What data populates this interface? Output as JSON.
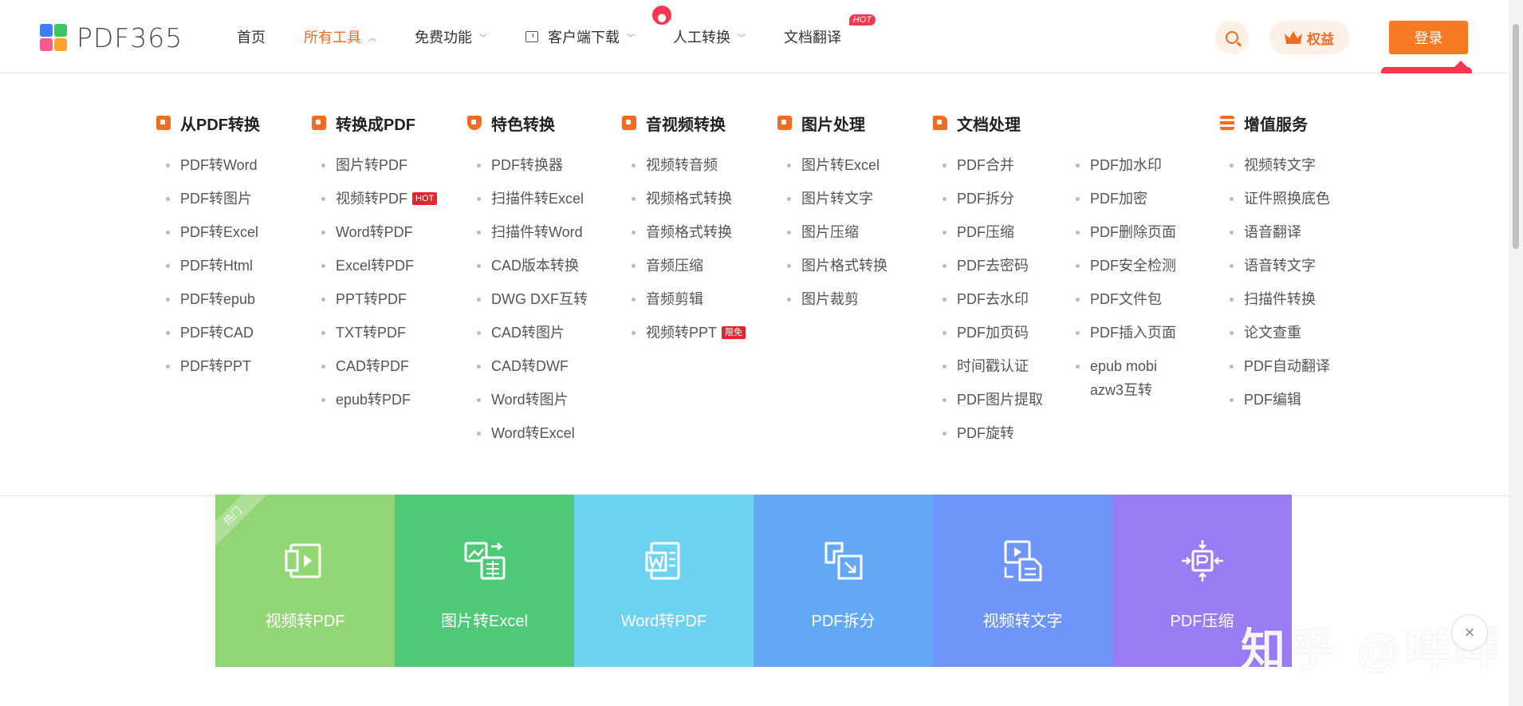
{
  "header": {
    "logo_text": "PDF365",
    "nav": [
      {
        "label": "首页"
      },
      {
        "label": "所有工具"
      },
      {
        "label": "免费功能"
      },
      {
        "label": "客户端下载"
      },
      {
        "label": "人工转换"
      },
      {
        "label": "文档翻译",
        "badge": "HOT"
      }
    ],
    "rights_label": "权益",
    "login_label": "登录"
  },
  "menu": {
    "columns": [
      {
        "title": "从PDF转换",
        "items": [
          "PDF转Word",
          "PDF转图片",
          "PDF转Excel",
          "PDF转Html",
          "PDF转epub",
          "PDF转CAD",
          "PDF转PPT"
        ]
      },
      {
        "title": "转换成PDF",
        "items": [
          "图片转PDF",
          "视频转PDF",
          "Word转PDF",
          "Excel转PDF",
          "PPT转PDF",
          "TXT转PDF",
          "CAD转PDF",
          "epub转PDF"
        ],
        "tag": "HOT"
      },
      {
        "title": "特色转换",
        "items": [
          "PDF转换器",
          "扫描件转Excel",
          "扫描件转Word",
          "CAD版本转换",
          "DWG DXF互转",
          "CAD转图片",
          "CAD转DWF",
          "Word转图片",
          "Word转Excel"
        ]
      },
      {
        "title": "音视频转换",
        "items": [
          "视频转音频",
          "视频格式转换",
          "音频格式转换",
          "音频压缩",
          "音频剪辑",
          "视频转PPT"
        ],
        "tag": "限免"
      },
      {
        "title": "图片处理",
        "items": [
          "图片转Excel",
          "图片转文字",
          "图片压缩",
          "图片格式转换",
          "图片裁剪"
        ]
      },
      {
        "title": "文档处理",
        "items": [
          "PDF合并",
          "PDF拆分",
          "PDF压缩",
          "PDF去密码",
          "PDF去水印",
          "PDF加页码",
          "时间戳认证",
          "PDF图片提取",
          "PDF旋转"
        ]
      },
      {
        "title": "",
        "items": [
          "PDF加水印",
          "PDF加密",
          "PDF删除页面",
          "PDF安全检测",
          "PDF文件包",
          "PDF插入页面",
          "epub mobi azw3互转"
        ]
      },
      {
        "title": "增值服务",
        "items": [
          "视频转文字",
          "证件照换底色",
          "语音翻译",
          "语音转文字",
          "扫描件转换",
          "论文查重",
          "PDF自动翻译",
          "PDF编辑"
        ]
      }
    ]
  },
  "tiles": {
    "hot_ribbon": "热门",
    "items": [
      {
        "label": "视频转PDF",
        "color": "#93d675",
        "icon": "video-to-pdf-icon"
      },
      {
        "label": "图片转Excel",
        "color": "#4ec977",
        "icon": "image-to-excel-icon"
      },
      {
        "label": "Word转PDF",
        "color": "#6ed2f1",
        "icon": "word-to-pdf-icon"
      },
      {
        "label": "PDF拆分",
        "color": "#63a8f5",
        "icon": "pdf-split-icon"
      },
      {
        "label": "视频转文字",
        "color": "#6e96f8",
        "icon": "video-to-text-icon"
      },
      {
        "label": "PDF压缩",
        "color": "#9a7cf5",
        "icon": "pdf-compress-icon"
      }
    ]
  },
  "watermark": "知乎 @咩咩",
  "colors": {
    "accent": "#f06c22",
    "hot": "#f6374f"
  }
}
